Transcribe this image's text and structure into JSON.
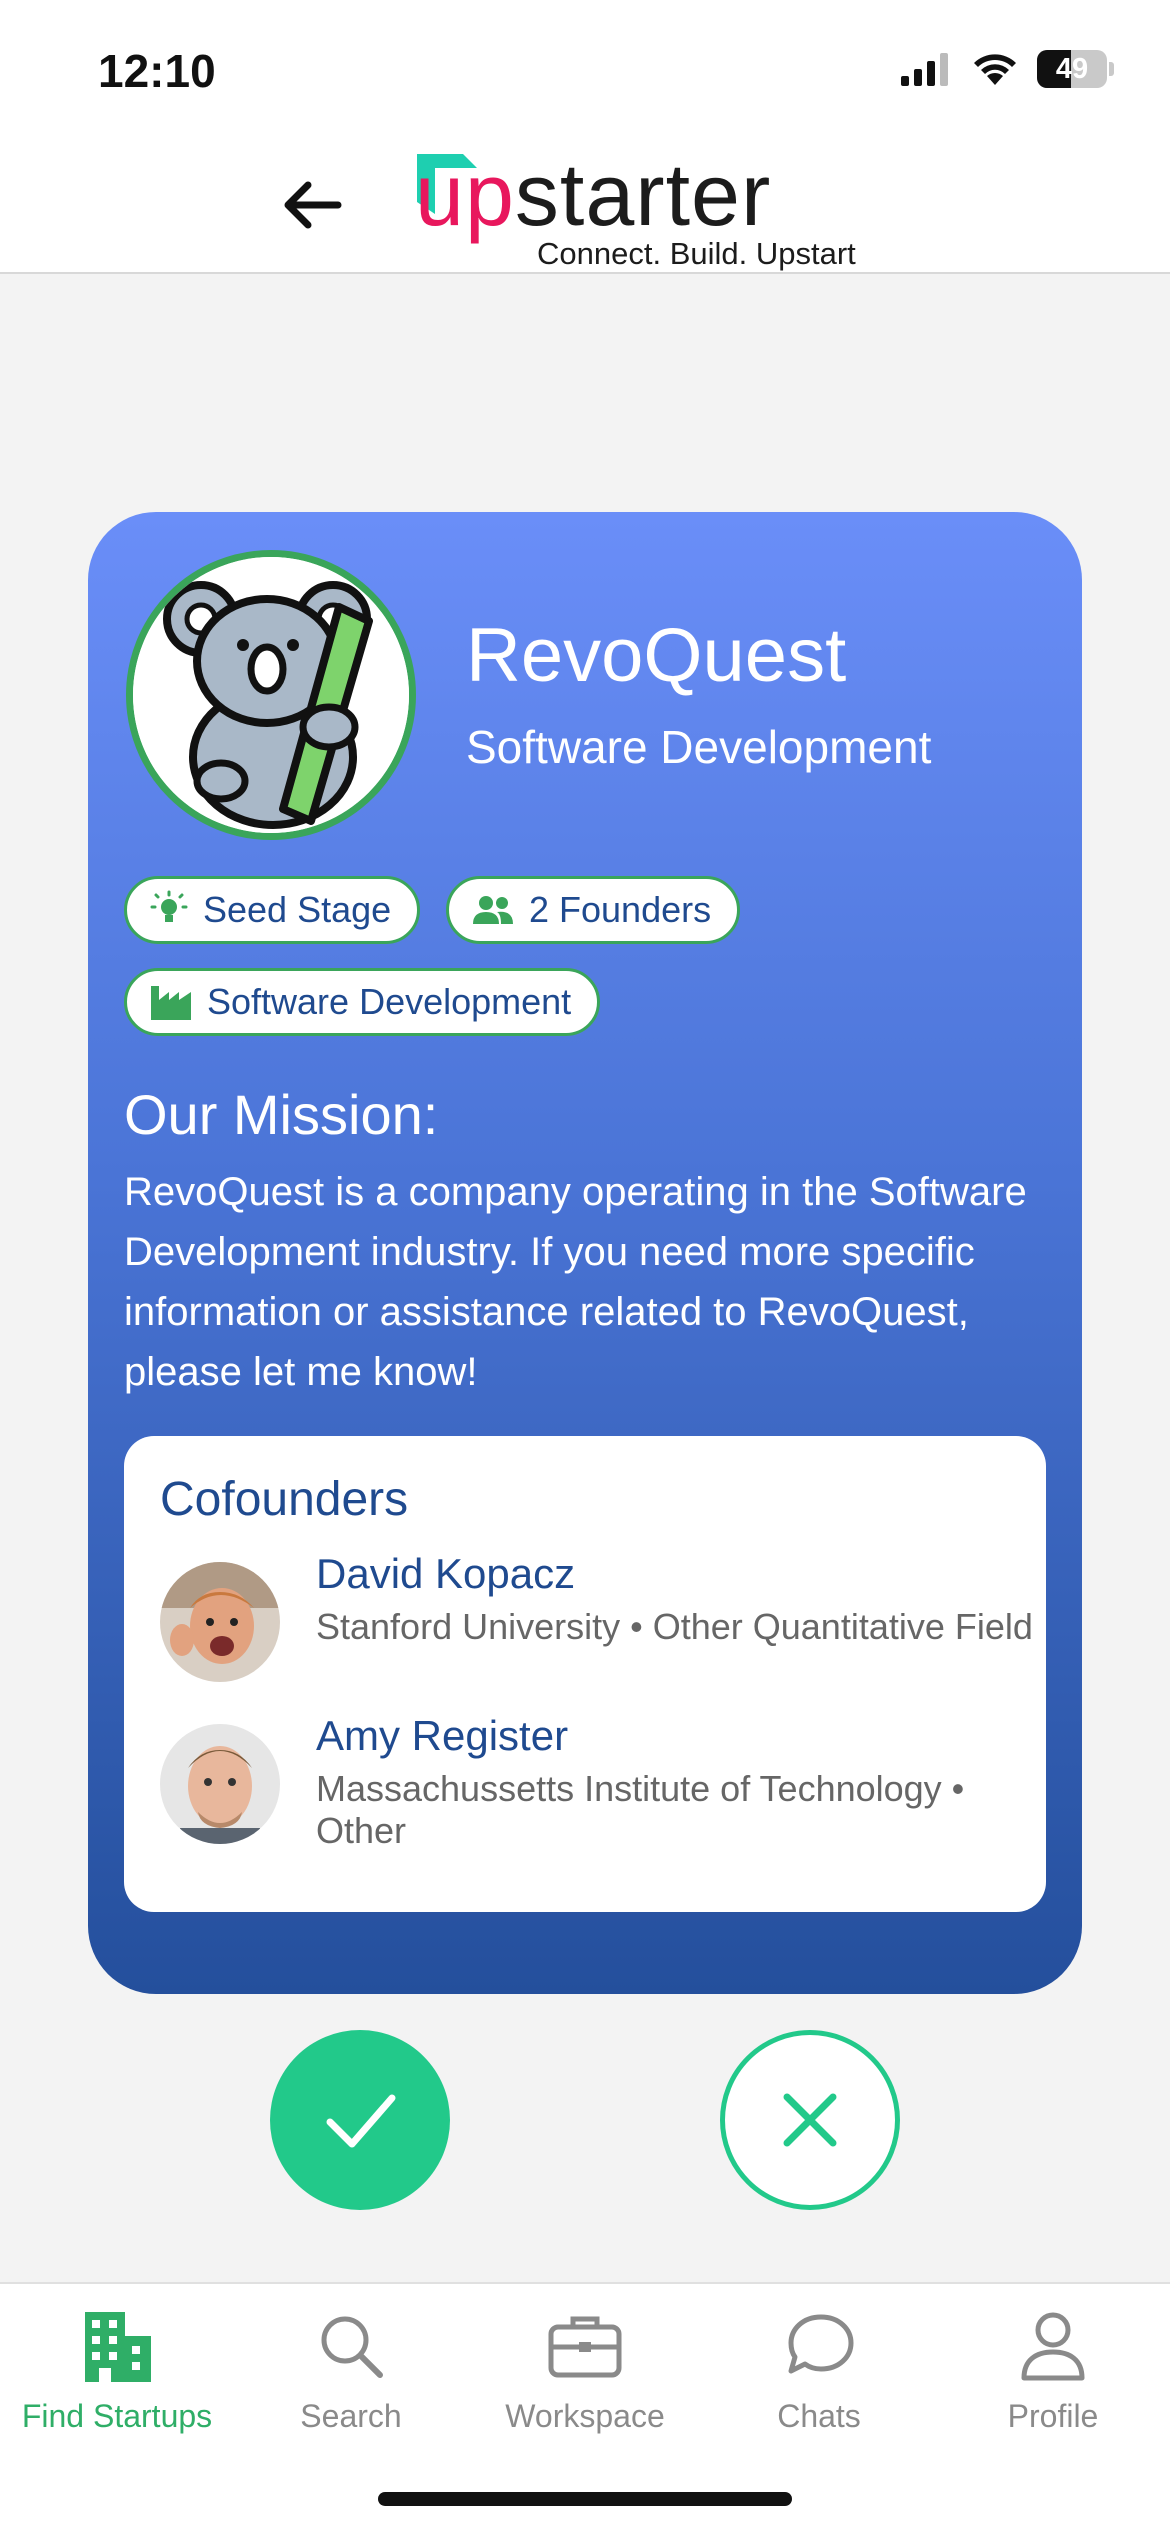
{
  "status_bar": {
    "time": "12:10",
    "battery": "49",
    "battery_level": 0.49
  },
  "header": {
    "logo": {
      "word_highlight": "up",
      "word_rest": "starter",
      "tagline": "Connect. Build. Upstart"
    }
  },
  "startup": {
    "name": "RevoQuest",
    "industry": "Software Development",
    "chips": [
      {
        "icon": "lightbulb-icon",
        "label": "Seed Stage"
      },
      {
        "icon": "people-icon",
        "label": "2 Founders"
      },
      {
        "icon": "factory-icon",
        "label": "Software Development"
      }
    ],
    "mission_title": "Our Mission:",
    "mission_text": "RevoQuest is a company operating in the Software Development industry. If you need more specific information or assistance related to RevoQuest, please let me know!"
  },
  "cofounders": {
    "title": "Cofounders",
    "people": [
      {
        "name": "David Kopacz",
        "detail": "Stanford University • Other Quantitative Field"
      },
      {
        "name": "Amy Register",
        "detail": "Massachussetts Institute of Technology • Other"
      }
    ]
  },
  "tabbar": {
    "tabs": [
      {
        "label": "Find Startups",
        "icon": "building-icon",
        "active": true
      },
      {
        "label": "Search",
        "icon": "search-icon",
        "active": false
      },
      {
        "label": "Workspace",
        "icon": "briefcase-icon",
        "active": false
      },
      {
        "label": "Chats",
        "icon": "chat-icon",
        "active": false
      },
      {
        "label": "Profile",
        "icon": "person-icon",
        "active": false
      }
    ]
  },
  "colors": {
    "accent_green": "#22c98a",
    "tab_active": "#2fae67",
    "card_top": "#6a8ef8",
    "card_bottom": "#244f9c",
    "text_blue": "#1f4a8f"
  }
}
